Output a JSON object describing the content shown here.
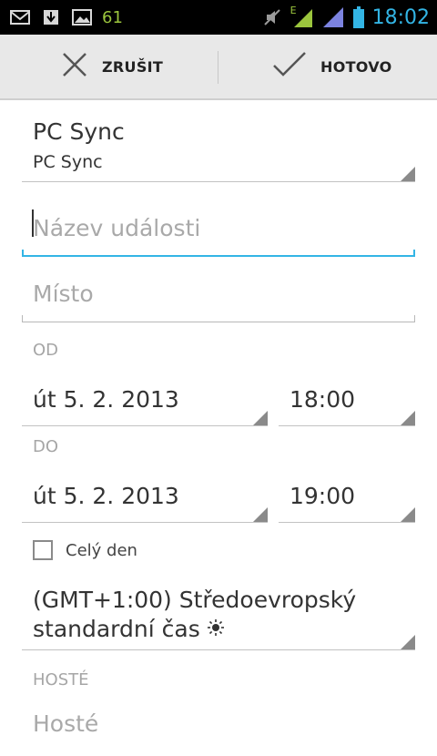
{
  "status_bar": {
    "notification_count": "61",
    "time": "18:02",
    "network_type": "E",
    "icons": [
      "gmail-icon",
      "download-icon",
      "gallery-icon",
      "mute-icon",
      "signal-icon",
      "signal2-icon",
      "battery-icon"
    ]
  },
  "action_bar": {
    "cancel_label": "ZRUŠIT",
    "done_label": "HOTOVO"
  },
  "calendar": {
    "name": "PC Sync",
    "account": "PC Sync"
  },
  "event": {
    "title_placeholder": "Název události",
    "location_placeholder": "Místo"
  },
  "from": {
    "label": "OD",
    "date": "út 5. 2. 2013",
    "time": "18:00"
  },
  "to": {
    "label": "DO",
    "date": "út 5. 2. 2013",
    "time": "19:00"
  },
  "all_day": {
    "label": "Celý den",
    "checked": false
  },
  "timezone": {
    "line1": "(GMT+1:00) Středoevropský",
    "line2": "standardní čas",
    "icon": "sun-icon"
  },
  "guests": {
    "label": "HOSTÉ",
    "placeholder": "Hosté"
  },
  "colors": {
    "accent": "#33b5e5",
    "status_green": "#9bc53d"
  }
}
